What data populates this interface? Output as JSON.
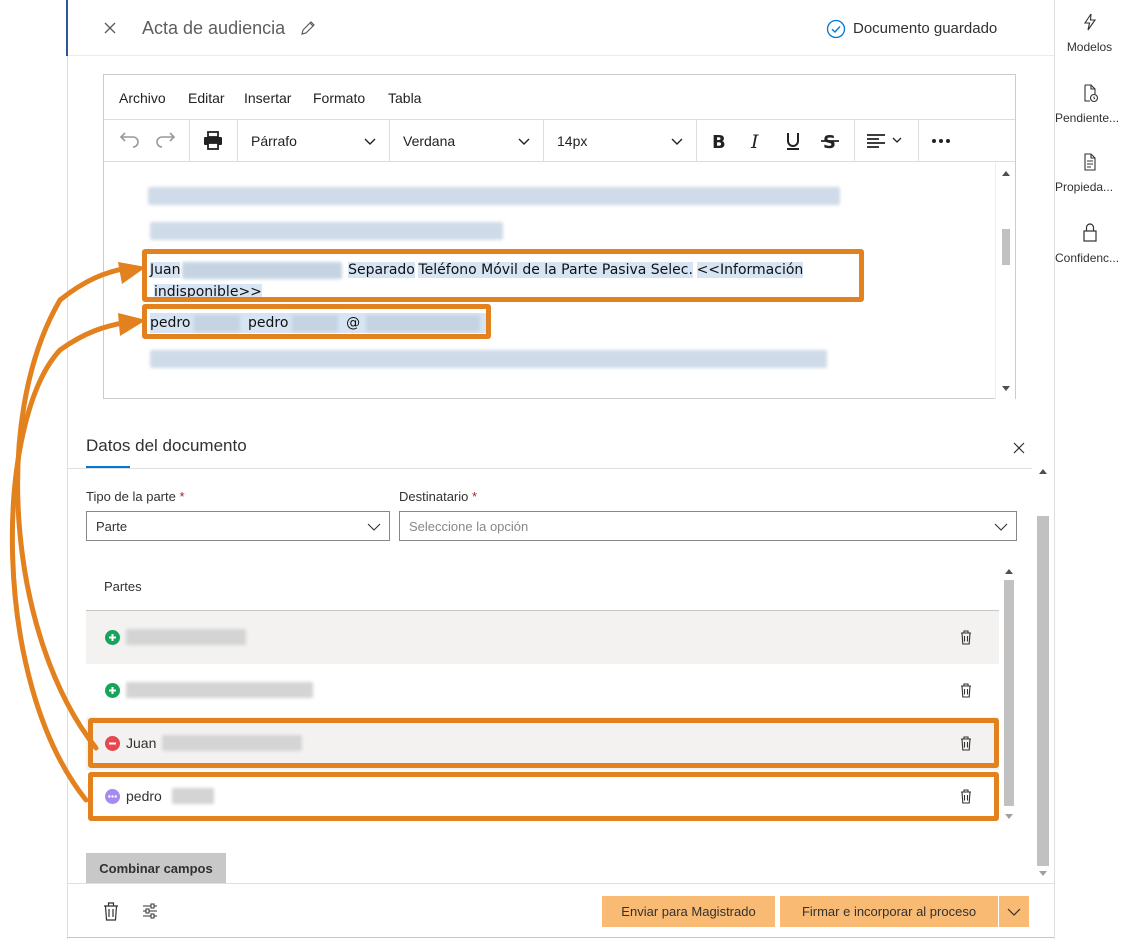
{
  "document": {
    "title": "Acta de audiencia",
    "status": "Documento guardado"
  },
  "right_sidebar": [
    {
      "label": "Modelos",
      "icon": "lightning-icon"
    },
    {
      "label": "Pendiente...",
      "icon": "document-clock-icon"
    },
    {
      "label": "Propieda...",
      "icon": "document-properties-icon"
    },
    {
      "label": "Confidenc...",
      "icon": "lock-icon"
    }
  ],
  "editor": {
    "menu": [
      "Archivo",
      "Editar",
      "Insertar",
      "Formato",
      "Tabla"
    ],
    "block_format": "Párrafo",
    "font_family": "Verdana",
    "font_size": "14px",
    "content": {
      "juan_line": {
        "name": "Juan",
        "separator": "Separado",
        "text1": "Teléfono Móvil de la Parte Pasiva Selec.",
        "text2": "<<Información",
        "text3": "indisponible>>"
      },
      "pedro_line": {
        "name1": "pedro",
        "name2": "pedro",
        "at": "@"
      }
    }
  },
  "panel": {
    "title": "Datos del documento",
    "party_type_label": "Tipo de la parte",
    "party_type_value": "Parte",
    "recipient_label": "Destinatario",
    "recipient_placeholder": "Seleccione la opción",
    "required_mark": "*",
    "parties_header": "Partes",
    "parties": [
      {
        "name": "",
        "status": "add",
        "status_color": "#16a35a"
      },
      {
        "name": "",
        "status": "add",
        "status_color": "#16a35a"
      },
      {
        "name": "Juan",
        "status": "remove",
        "status_color": "#e5484d"
      },
      {
        "name": "pedro",
        "status": "more",
        "status_color": "#a58bf0"
      }
    ],
    "combine_label": "Combinar campos"
  },
  "footer": {
    "send_label": "Enviar para Magistrado",
    "sign_label": "Firmar e incorporar al proceso"
  },
  "colors": {
    "accent": "#0078d4",
    "highlight_box": "#e2811e",
    "action_button": "#f9bb74"
  }
}
